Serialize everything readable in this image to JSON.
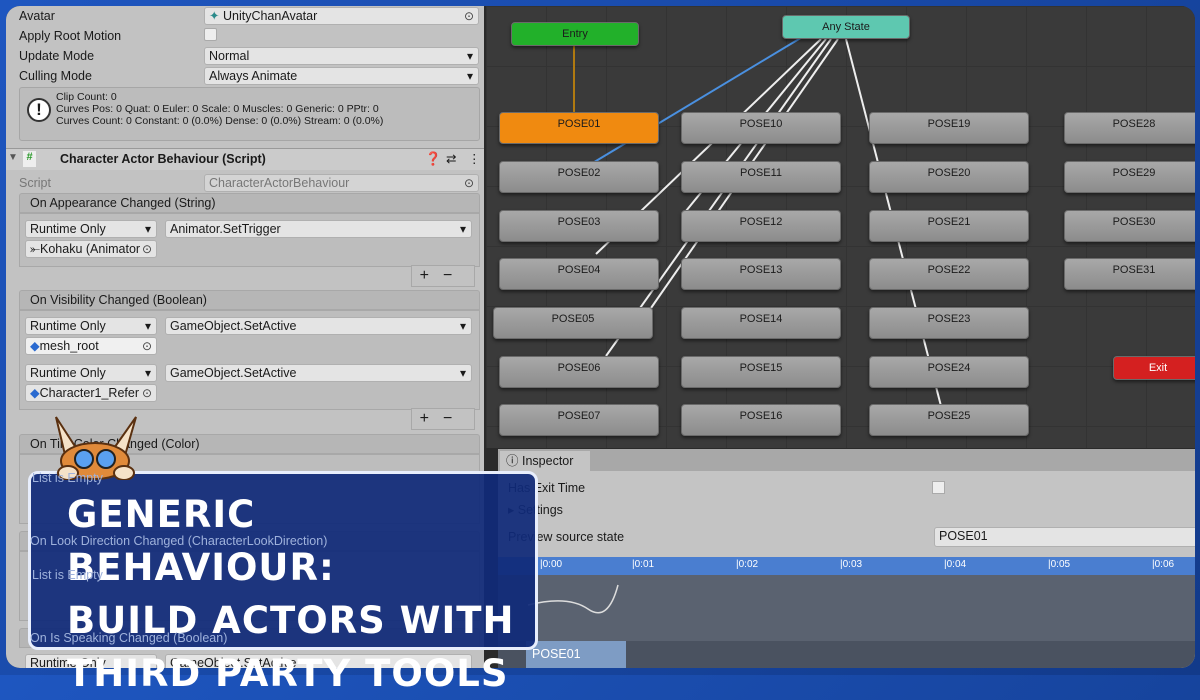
{
  "inspector": {
    "avatar_label": "Avatar",
    "avatar_value": "UnityChanAvatar",
    "root_motion_label": "Apply Root Motion",
    "root_motion_checked": false,
    "update_label": "Update Mode",
    "update_value": "Normal",
    "culling_label": "Culling Mode",
    "culling_value": "Always Animate",
    "info_lines": [
      "Clip Count: 0",
      "Curves Pos: 0 Quat: 0 Euler: 0 Scale: 0 Muscles: 0 Generic: 0 PPtr: 0",
      "Curves Count: 0 Constant: 0 (0.0%) Dense: 0 (0.0%) Stream: 0 (0.0%)"
    ],
    "component_title": "Character Actor Behaviour (Script)",
    "script_label": "Script",
    "script_value": "CharacterActorBehaviour",
    "events": [
      {
        "title": "On Appearance Changed (String)",
        "entries": [
          {
            "mode": "Runtime Only",
            "func": "Animator.SetTrigger",
            "target": "Kohaku (Animator"
          }
        ]
      },
      {
        "title": "On Visibility Changed (Boolean)",
        "entries": [
          {
            "mode": "Runtime Only",
            "func": "GameObject.SetActive",
            "target": "mesh_root"
          },
          {
            "mode": "Runtime Only",
            "func": "GameObject.SetActive",
            "target": "Character1_Refer"
          }
        ]
      },
      {
        "title": "On Tint Color Changed (Color)",
        "empty": "List is Empty"
      },
      {
        "title": "On Look Direction Changed (CharacterLookDirection)",
        "empty": "List is Empty"
      },
      {
        "title": "On Is Speaking Changed (Boolean)",
        "entries": [
          {
            "mode": "Runtime Only",
            "func": "GameObject.SetActive"
          }
        ]
      }
    ],
    "plus": "+",
    "minus": "−"
  },
  "animator": {
    "entry": "Entry",
    "any_state": "Any State",
    "exit": "Exit",
    "columns": [
      [
        "POSE01",
        "POSE02",
        "POSE03",
        "POSE04",
        "POSE05",
        "POSE06",
        "POSE07"
      ],
      [
        "POSE10",
        "POSE11",
        "POSE12",
        "POSE13",
        "POSE14",
        "POSE15",
        "POSE16"
      ],
      [
        "POSE19",
        "POSE20",
        "POSE21",
        "POSE22",
        "POSE23",
        "POSE24",
        "POSE25"
      ],
      [
        "POSE28",
        "POSE29",
        "POSE30",
        "POSE31"
      ]
    ],
    "selected": "POSE01",
    "colors": {
      "entry": "#22b02a",
      "any_state": "#5ec8b0",
      "exit": "#d42020",
      "selected": "#f08a10",
      "transition_blue": "#4a90e0"
    }
  },
  "transition_inspector": {
    "tab": "Inspector",
    "has_exit_time": "Has Exit Time",
    "settings": "Settings",
    "preview_label": "Preview source state",
    "preview_value": "POSE01",
    "ticks": [
      "0:00",
      "0:01",
      "0:02",
      "0:03",
      "0:04",
      "0:05",
      "0:06"
    ],
    "clip": "POSE01"
  },
  "overlay": {
    "lines": [
      "GENERIC BEHAVIOUR:",
      "BUILD ACTORS WITH",
      "THIRD PARTY TOOLS"
    ]
  }
}
